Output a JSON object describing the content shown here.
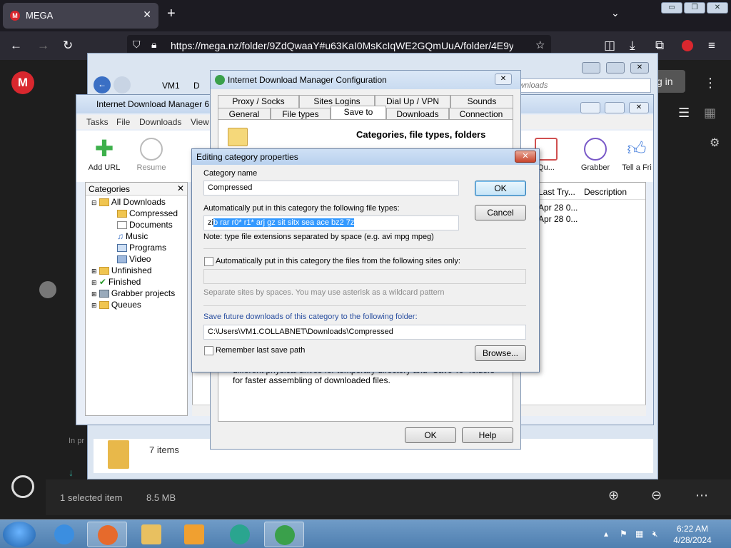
{
  "browser": {
    "tab_title": "MEGA",
    "url": "https://mega.nz/folder/9ZdQwaaY#u63KaI0MsKcIqWE2GQmUuA/folder/4E9ymID"
  },
  "mega": {
    "login_label": "g in",
    "folder_items": "7 items",
    "selected_label": "1 selected item",
    "selected_size": "8.5 MB",
    "in_progress": "In pr"
  },
  "explorer": {
    "path_vm1": "VM1",
    "path_d": "D",
    "search_placeholder": "wnloads"
  },
  "idm": {
    "title": "Internet Download Manager 6.",
    "menu": [
      "Tasks",
      "File",
      "Downloads",
      "View"
    ],
    "toolbar": {
      "add_url": "Add URL",
      "resume": "Resume",
      "queue": "Qu...",
      "grabber": "Grabber",
      "tell": "Tell a Fri"
    },
    "categories_header": "Categories",
    "categories": [
      "All Downloads",
      "Compressed",
      "Documents",
      "Music",
      "Programs",
      "Video",
      "Unfinished",
      "Finished",
      "Grabber projects",
      "Queues"
    ],
    "columns": [
      "Last Try...",
      "Description"
    ],
    "rows": [
      "Apr 28 0...",
      "Apr 28 0..."
    ]
  },
  "config": {
    "title": "Internet Download Manager Configuration",
    "tabs_row1": [
      "Proxy / Socks",
      "Sites Logins",
      "Dial Up / VPN",
      "Sounds"
    ],
    "tabs_row2": [
      "General",
      "File types",
      "Save to",
      "Downloads",
      "Connection"
    ],
    "heading": "Categories, file types, folders",
    "note": "different physical drives for temporary directory and \"Save To\" folders for faster assembling of downloaded files.",
    "ok": "OK",
    "help": "Help"
  },
  "edit_dialog": {
    "title": "Editing category properties",
    "category_name_label": "Category name",
    "category_name": "Compressed",
    "file_types_label": "Automatically put in this category the following file types:",
    "file_types_prefix": "zi",
    "file_types_selected": "b rar r0* r1* arj gz sit sitx sea ace bz2 7z",
    "note": "Note: type file extensions separated by space (e.g. avi mpg mpeg)",
    "sites_label": "Automatically put in this category the files from the following sites only:",
    "sites_value": "",
    "sites_hint": "Separate sites by spaces. You may use asterisk as a wildcard pattern",
    "folder_label": "Save future downloads of this category to the following folder:",
    "folder_value": "C:\\Users\\VM1.COLLABNET\\Downloads\\Compressed",
    "remember_label": "Remember last save path",
    "ok": "OK",
    "cancel": "Cancel",
    "browse": "Browse..."
  },
  "taskbar": {
    "time": "6:22 AM",
    "date": "4/28/2024"
  }
}
